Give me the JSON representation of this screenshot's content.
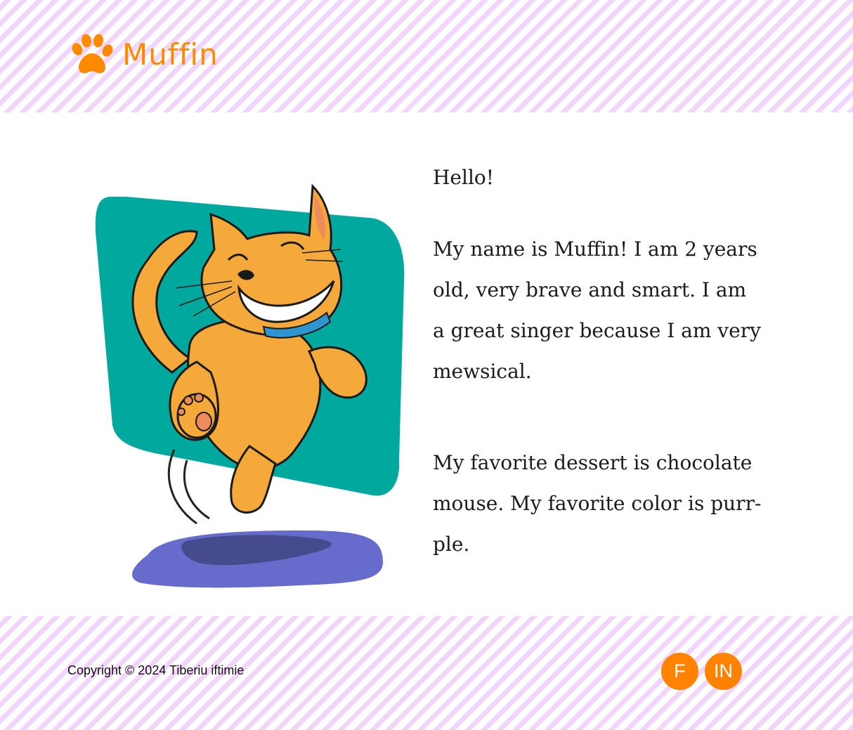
{
  "brand": {
    "name": "Muffin",
    "logo_icon": "paw-icon",
    "accent_color": "#ff8a00"
  },
  "hero": {
    "illustration": "cat-illustration",
    "panel_color": "#00a89d",
    "mat_color": "#676bcc"
  },
  "about": {
    "greeting": "Hello!",
    "paragraph1": "My name is Muffin! I am 2 years old, very brave and smart. I am a great singer because I am very mewsical.",
    "paragraph2": "My favorite dessert is chocolate mouse. My favorite color is purr-ple."
  },
  "footer": {
    "copyright": "Copyright © 2024 Tiberiu iftimie",
    "social": [
      {
        "label": "F",
        "icon": "facebook-icon"
      },
      {
        "label": "IN",
        "icon": "linkedin-icon"
      }
    ],
    "button_color": "#ff8200"
  }
}
